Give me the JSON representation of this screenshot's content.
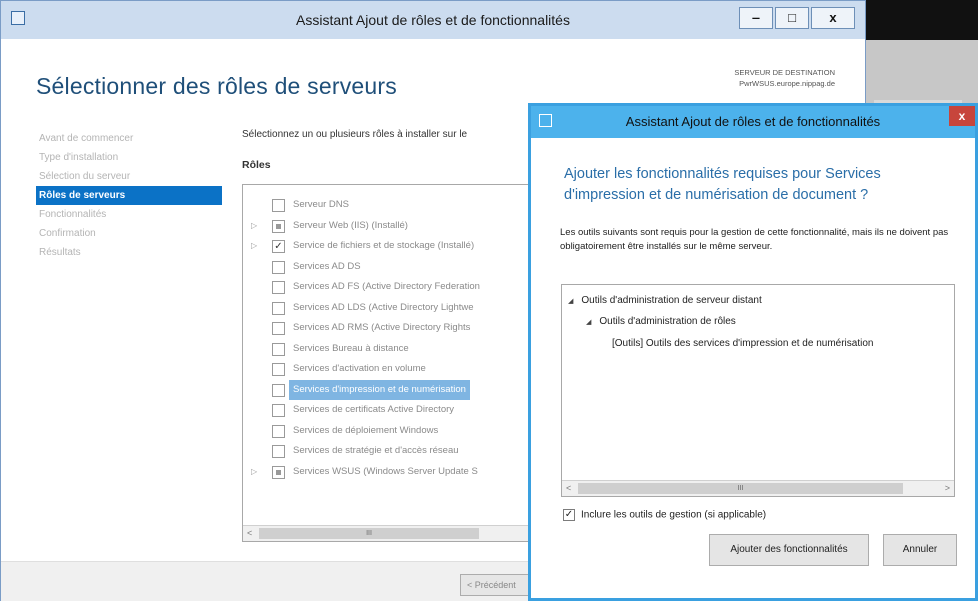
{
  "main": {
    "title": "Assistant Ajout de rôles et de fonctionnalités",
    "window_buttons": {
      "minimize": "‒",
      "maximize": "□",
      "close": "x"
    },
    "heading": "Sélectionner des rôles de serveurs",
    "destination_label": "SERVEUR DE DESTINATION",
    "destination_server": "PwrWSUS.europe.nippag.de",
    "nav": [
      {
        "label": "Avant de commencer",
        "active": false
      },
      {
        "label": "Type d'installation",
        "active": false
      },
      {
        "label": "Sélection du serveur",
        "active": false
      },
      {
        "label": "Rôles de serveurs",
        "active": true
      },
      {
        "label": "Fonctionnalités",
        "active": false
      },
      {
        "label": "Confirmation",
        "active": false
      },
      {
        "label": "Résultats",
        "active": false
      }
    ],
    "instruction": "Sélectionnez un ou plusieurs rôles à installer sur le",
    "roles_header": "Rôles",
    "roles": [
      {
        "label": "Serveur DNS",
        "state": "unchecked",
        "expandable": false
      },
      {
        "label": "Serveur Web (IIS) (Installé)",
        "state": "partial",
        "expandable": true
      },
      {
        "label": "Service de fichiers et de stockage (Installé)",
        "state": "checked",
        "expandable": true
      },
      {
        "label": "Services AD DS",
        "state": "unchecked",
        "expandable": false
      },
      {
        "label": "Services AD FS (Active Directory Federation",
        "state": "unchecked",
        "expandable": false
      },
      {
        "label": "Services AD LDS (Active Directory Lightwe",
        "state": "unchecked",
        "expandable": false
      },
      {
        "label": "Services AD RMS (Active Directory Rights",
        "state": "unchecked",
        "expandable": false
      },
      {
        "label": "Services Bureau à distance",
        "state": "unchecked",
        "expandable": false
      },
      {
        "label": "Services d'activation en volume",
        "state": "unchecked",
        "expandable": false
      },
      {
        "label": "Services d'impression et de numérisation",
        "state": "unchecked",
        "expandable": false,
        "selected": true
      },
      {
        "label": "Services de certificats Active Directory",
        "state": "unchecked",
        "expandable": false
      },
      {
        "label": "Services de déploiement Windows",
        "state": "unchecked",
        "expandable": false
      },
      {
        "label": "Services de stratégie et d'accès réseau",
        "state": "unchecked",
        "expandable": false
      },
      {
        "label": "Services WSUS (Windows Server Update S",
        "state": "partial",
        "expandable": true
      }
    ],
    "prev_button": "< Précédent"
  },
  "dialog": {
    "title": "Assistant Ajout de rôles et de fonctionnalités",
    "close": "x",
    "question": "Ajouter les fonctionnalités requises pour Services d'impression et de numérisation de document ?",
    "description": "Les outils suivants sont requis pour la gestion de cette fonctionnalité, mais ils ne doivent pas obligatoirement être installés sur le même serveur.",
    "tree": [
      {
        "label": "Outils d'administration de serveur distant",
        "level": 0,
        "expanded": true
      },
      {
        "label": "Outils d'administration de rôles",
        "level": 1,
        "expanded": true
      },
      {
        "label": "[Outils] Outils des services d'impression et de numérisation",
        "level": 2,
        "expanded": false
      }
    ],
    "include_label": "Inclure les outils de gestion (si applicable)",
    "include_checked": true,
    "add_button": "Ajouter des fonctionnalités",
    "cancel_button": "Annuler"
  },
  "scroll_glyphs": {
    "left": "<",
    "right": ">",
    "thumb": "III"
  },
  "colors": {
    "accent": "#0b72c6",
    "dialog_border": "#3aa0e0",
    "heading": "#1f4f79",
    "selected_row": "#7fb5e2"
  }
}
